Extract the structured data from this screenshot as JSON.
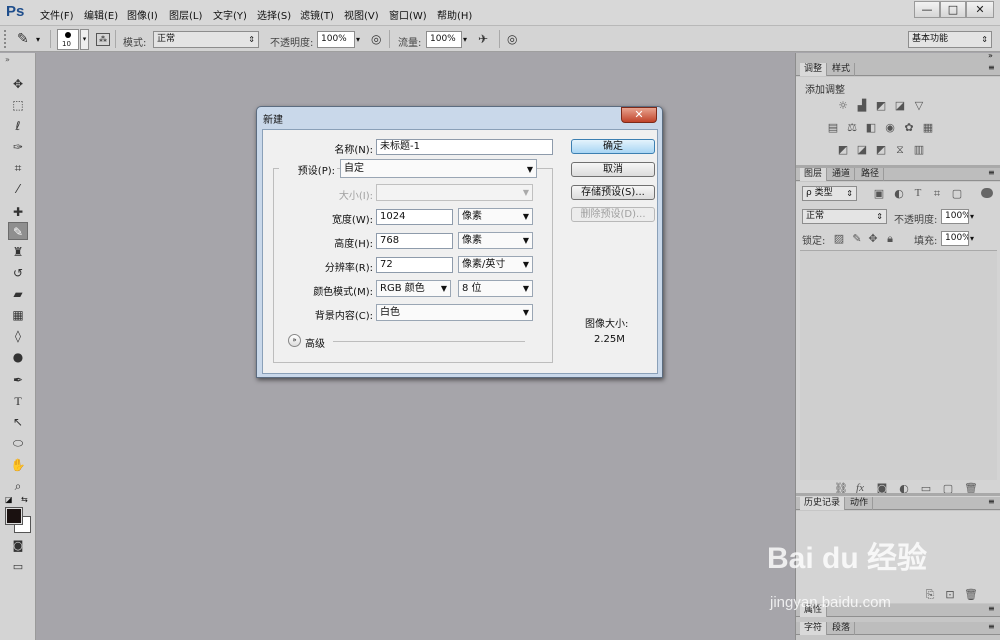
{
  "app": {
    "logo": "Ps"
  },
  "menu": [
    "文件(F)",
    "编辑(E)",
    "图像(I)",
    "图层(L)",
    "文字(Y)",
    "选择(S)",
    "滤镜(T)",
    "视图(V)",
    "窗口(W)",
    "帮助(H)"
  ],
  "window_controls": {
    "minimize": "—",
    "restore": "□",
    "close": "✕"
  },
  "options_bar": {
    "brush_size": "10",
    "mode_label": "模式:",
    "mode_value": "正常",
    "opacity_label": "不透明度:",
    "opacity_value": "100%",
    "flow_label": "流量:",
    "flow_value": "100%",
    "workspace": "基本功能"
  },
  "panels": {
    "adjustments_tab": "调整",
    "styles_tab": "样式",
    "add_adjustment": "添加调整",
    "layers_tab": "图层",
    "channels_tab": "通道",
    "paths_tab": "路径",
    "kind_filter": "ρ 类型",
    "blend_mode": "正常",
    "opacity_label": "不透明度:",
    "opacity_value": "100%",
    "lock_label": "锁定:",
    "fill_label": "填充:",
    "fill_value": "100%",
    "history_tab": "历史记录",
    "actions_tab": "动作",
    "properties_tab": "属性",
    "character_tab": "字符",
    "paragraph_tab": "段落"
  },
  "dialog": {
    "title": "新建",
    "close": "✕",
    "name_label": "名称(N):",
    "name_value": "未标题-1",
    "preset_label": "预设(P):",
    "preset_value": "自定",
    "size_label": "大小(I):",
    "size_value": "",
    "width_label": "宽度(W):",
    "width_value": "1024",
    "width_unit": "像素",
    "height_label": "高度(H):",
    "height_value": "768",
    "height_unit": "像素",
    "resolution_label": "分辨率(R):",
    "resolution_value": "72",
    "resolution_unit": "像素/英寸",
    "color_mode_label": "颜色模式(M):",
    "color_mode_value": "RGB 颜色",
    "bit_depth": "8 位",
    "background_label": "背景内容(C):",
    "background_value": "白色",
    "advanced": "高级",
    "ok": "确定",
    "cancel": "取消",
    "save_preset": "存储预设(S)...",
    "delete_preset": "删除预设(D)...",
    "image_size_label": "图像大小:",
    "image_size_value": "2.25M"
  },
  "watermark": {
    "logo": "Bai du 经验",
    "url": "jingyan.baidu.com"
  },
  "colors": {
    "canvas": "#a6a5aa",
    "dialog_frame": "#c9d8ea",
    "primary_button": "#a8d5f4",
    "ps_blue": "#1f4e8c"
  }
}
